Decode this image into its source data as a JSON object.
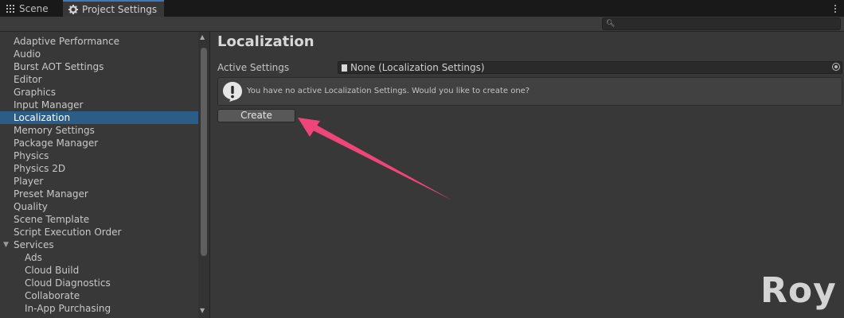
{
  "tabs": [
    {
      "label": "Scene",
      "icon": "grid-icon"
    },
    {
      "label": "Project Settings",
      "icon": "gear-icon",
      "active": true
    }
  ],
  "nav": {
    "items": [
      {
        "label": "Adaptive Performance",
        "level": 0
      },
      {
        "label": "Audio",
        "level": 0
      },
      {
        "label": "Burst AOT Settings",
        "level": 0
      },
      {
        "label": "Editor",
        "level": 0
      },
      {
        "label": "Graphics",
        "level": 0
      },
      {
        "label": "Input Manager",
        "level": 0
      },
      {
        "label": "Localization",
        "level": 0,
        "selected": true
      },
      {
        "label": "Memory Settings",
        "level": 0
      },
      {
        "label": "Package Manager",
        "level": 0
      },
      {
        "label": "Physics",
        "level": 0
      },
      {
        "label": "Physics 2D",
        "level": 0
      },
      {
        "label": "Player",
        "level": 0
      },
      {
        "label": "Preset Manager",
        "level": 0
      },
      {
        "label": "Quality",
        "level": 0
      },
      {
        "label": "Scene Template",
        "level": 0
      },
      {
        "label": "Script Execution Order",
        "level": 0
      },
      {
        "label": "Services",
        "level": 0,
        "expanded": true
      },
      {
        "label": "Ads",
        "level": 1
      },
      {
        "label": "Cloud Build",
        "level": 1
      },
      {
        "label": "Cloud Diagnostics",
        "level": 1
      },
      {
        "label": "Collaborate",
        "level": 1
      },
      {
        "label": "In-App Purchasing",
        "level": 1
      }
    ]
  },
  "main": {
    "title": "Localization",
    "active_settings_label": "Active Settings",
    "active_settings_value": "None (Localization Settings)",
    "help_message": "You have no active Localization Settings. Would you like to create one?",
    "create_label": "Create"
  },
  "watermark": "Roy",
  "colors": {
    "selection": "#2c5d87",
    "annotation_arrow": "#f0457a",
    "tab_accent": "#3a79bb"
  }
}
